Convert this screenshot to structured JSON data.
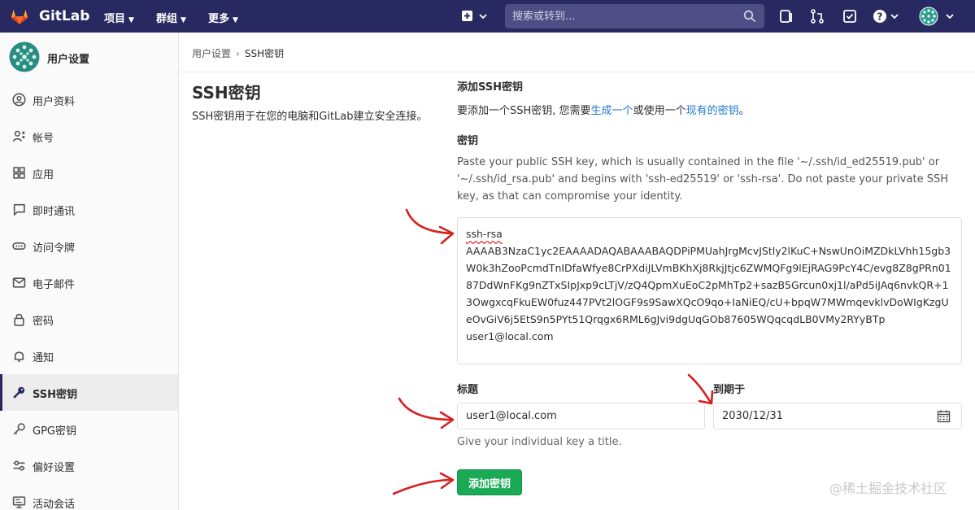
{
  "navbar": {
    "brand": "GitLab",
    "menus": [
      {
        "label": "项目"
      },
      {
        "label": "群组"
      },
      {
        "label": "更多"
      }
    ],
    "search_placeholder": "搜索或转到...",
    "colors": {
      "bg": "#292961",
      "search_bg": "#4e4e85"
    }
  },
  "sidebar": {
    "title": "用户设置",
    "items": [
      {
        "label": "用户资料",
        "icon": "profile-icon"
      },
      {
        "label": "帐号",
        "icon": "account-icon"
      },
      {
        "label": "应用",
        "icon": "applications-icon"
      },
      {
        "label": "即时通讯",
        "icon": "chat-icon"
      },
      {
        "label": "访问令牌",
        "icon": "token-icon"
      },
      {
        "label": "电子邮件",
        "icon": "email-icon"
      },
      {
        "label": "密码",
        "icon": "lock-icon"
      },
      {
        "label": "通知",
        "icon": "bell-icon"
      },
      {
        "label": "SSH密钥",
        "icon": "key-icon",
        "active": true
      },
      {
        "label": "GPG密钥",
        "icon": "key-icon"
      },
      {
        "label": "偏好设置",
        "icon": "preferences-icon"
      },
      {
        "label": "活动会话",
        "icon": "monitor-icon"
      }
    ]
  },
  "breadcrumb": {
    "parent": "用户设置",
    "sep": "›",
    "current": "SSH密钥"
  },
  "page": {
    "title": "SSH密钥",
    "description": "SSH密钥用于在您的电脑和GitLab建立安全连接。"
  },
  "add_section": {
    "title": "添加SSH密钥",
    "intro_before": "要添加一个SSH密钥, 您需要",
    "link_generate": "生成一个",
    "intro_middle": "或使用一个",
    "link_existing": "现有的密钥",
    "intro_after": "。"
  },
  "key_field": {
    "label": "密钥",
    "help": "Paste your public SSH key, which is usually contained in the file '~/.ssh/id_ed25519.pub' or '~/.ssh/id_rsa.pub' and begins with 'ssh-ed25519' or 'ssh-rsa'. Do not paste your private SSH key, as that can compromise your identity.",
    "key_type": "ssh-rsa",
    "key_body": "AAAAB3NzaC1yc2EAAAADAQABAAABAQDPiPMUahJrgMcvJStly2lKuC+NswUnOiMZDkLVhh15gb3W0k3hZooPcmdTnIDfaWfye8CrPXdiJLVmBKhXj8RkjJtjc6ZWMQFg9lEjRAG9PcY4C/evg8Z8gPRn0187DdWnFKg9nZTxSIpJxp9cLTjV/zQ4QpmXuEoC2pMhTp2+sazB5Grcun0xj1l/aPd5iJAq6nvkQR+13OwgxcqFkuEW0fuz447PVt2lOGF9s9SawXQcO9qo+IaNiEQ/cU+bpqW7MWmqevklvDoWIgKzgUeOvGiV6j5EtS9n5PYt51Qrqgx6RML6gJvi9dgUqGOb87605WQqcqdLB0VMy2RYyBTp",
    "key_comment": "user1@local.com"
  },
  "title_field": {
    "label": "标题",
    "value": "user1@local.com",
    "hint": "Give your individual key a title."
  },
  "expires_field": {
    "label": "到期于",
    "value": "2030/12/31"
  },
  "submit": {
    "label": "添加密钥",
    "color": "#1aaa55"
  },
  "watermark": "@稀土掘金技术社区",
  "annotation_color": "#d62020"
}
